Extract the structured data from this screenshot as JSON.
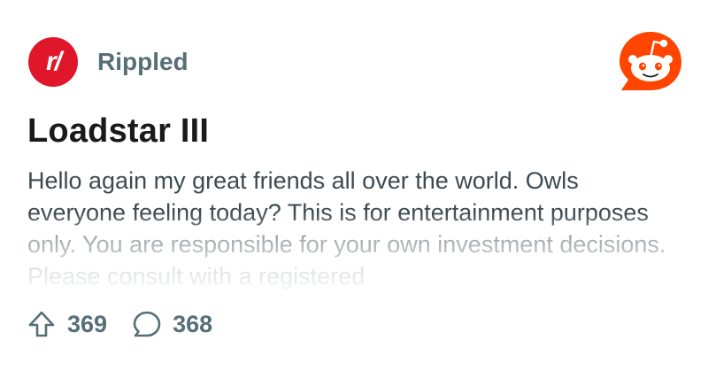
{
  "subreddit": {
    "avatar_text": "r/",
    "name": "Rippled",
    "avatar_color": "#e0162b"
  },
  "brand": {
    "logo_icon": "reddit-snoo-icon",
    "color": "#ff4500"
  },
  "post": {
    "title": "Loadstar III",
    "body": "Hello again my great friends all over the world. Owls everyone feeling today? This is for entertainment purposes only. You are responsible for your own investment decisions. Please consult with a registered"
  },
  "stats": {
    "upvotes": "369",
    "upvote_icon": "upvote-arrow-icon",
    "comments": "368",
    "comment_icon": "comment-bubble-icon"
  }
}
